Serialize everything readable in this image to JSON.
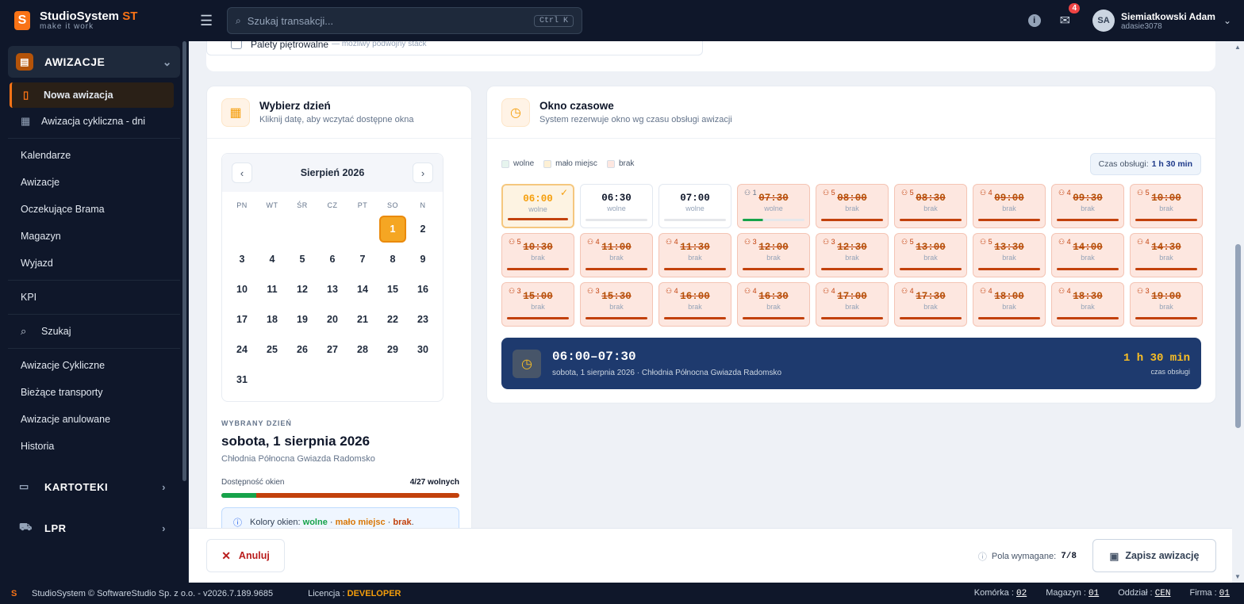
{
  "app": {
    "name": "StudioSystem",
    "suffix": "ST",
    "tagline": "make it work"
  },
  "search": {
    "placeholder": "Szukaj transakcji...",
    "shortcut": "Ctrl K"
  },
  "header": {
    "info_icon": "info-icon",
    "mail_badge": "4",
    "user_name": "Siemiatkowski Adam",
    "user_login": "adasie3078"
  },
  "sidebar": {
    "group1": "AWIZACJE",
    "sub": [
      {
        "label": "Nowa awizacja"
      },
      {
        "label": "Awizacja cykliczna - dni"
      }
    ],
    "items": [
      "Kalendarze",
      "Awizacje",
      "Oczekujące Brama",
      "Magazyn",
      "Wyjazd",
      "KPI",
      "Szukaj",
      "Awizacje Cykliczne",
      "Bieżące transporty",
      "Awizacje anulowane",
      "Historia"
    ],
    "group2": "KARTOTEKI",
    "group3": "LPR"
  },
  "pallets": {
    "label": "Palety piętrowalne",
    "note": "— możliwy podwójny stack"
  },
  "day_card": {
    "title": "Wybierz dzień",
    "subtitle": "Kliknij datę, aby wczytać dostępne okna"
  },
  "calendar": {
    "month": "Sierpień 2026",
    "weekdays": [
      "PN",
      "WT",
      "ŚR",
      "CZ",
      "PT",
      "SO",
      "N"
    ],
    "days": [
      "",
      "",
      "",
      "",
      "",
      "1",
      "2",
      "3",
      "4",
      "5",
      "6",
      "7",
      "8",
      "9",
      "10",
      "11",
      "12",
      "13",
      "14",
      "15",
      "16",
      "17",
      "18",
      "19",
      "20",
      "21",
      "22",
      "23",
      "24",
      "25",
      "26",
      "27",
      "28",
      "29",
      "30",
      "31"
    ],
    "selected": "1"
  },
  "picked": {
    "label": "WYBRANY DZIEŃ",
    "date": "sobota, 1 sierpnia 2026",
    "location": "Chłodnia Północna Gwiazda Radomsko",
    "avail_label": "Dostępność okien",
    "avail_value": "4/27 wolnych",
    "avail_fraction": 0.148,
    "info_prefix": "Kolory okien:",
    "info_free": "wolne",
    "info_few": "mało miejsc",
    "info_none": "brak"
  },
  "window_card": {
    "title": "Okno czasowe",
    "subtitle": "System rezerwuje okno wg czasu obsługi awizacji"
  },
  "legend": [
    {
      "label": "wolne",
      "color": "#e6f4ee"
    },
    {
      "label": "mało miejsc",
      "color": "#fdf0d5"
    },
    {
      "label": "brak",
      "color": "#fde7e0"
    }
  ],
  "service_time": {
    "label": "Czas obsługi:",
    "value": "1 h 30 min"
  },
  "slots": [
    {
      "time": "06:00",
      "status": "wolne",
      "kind": "selected",
      "people": ""
    },
    {
      "time": "06:30",
      "status": "wolne",
      "kind": "free",
      "people": ""
    },
    {
      "time": "07:00",
      "status": "wolne",
      "kind": "free",
      "people": ""
    },
    {
      "time": "07:30",
      "status": "wolne",
      "kind": "partial",
      "people": "1"
    },
    {
      "time": "08:00",
      "status": "brak",
      "kind": "full",
      "people": "5"
    },
    {
      "time": "08:30",
      "status": "brak",
      "kind": "full",
      "people": "5"
    },
    {
      "time": "09:00",
      "status": "brak",
      "kind": "full",
      "people": "4"
    },
    {
      "time": "09:30",
      "status": "brak",
      "kind": "full",
      "people": "4"
    },
    {
      "time": "10:00",
      "status": "brak",
      "kind": "full",
      "people": "5"
    },
    {
      "time": "10:30",
      "status": "brak",
      "kind": "full",
      "people": "5"
    },
    {
      "time": "11:00",
      "status": "brak",
      "kind": "full",
      "people": "4"
    },
    {
      "time": "11:30",
      "status": "brak",
      "kind": "full",
      "people": "4"
    },
    {
      "time": "12:00",
      "status": "brak",
      "kind": "full",
      "people": "3"
    },
    {
      "time": "12:30",
      "status": "brak",
      "kind": "full",
      "people": "3"
    },
    {
      "time": "13:00",
      "status": "brak",
      "kind": "full",
      "people": "5"
    },
    {
      "time": "13:30",
      "status": "brak",
      "kind": "full",
      "people": "5"
    },
    {
      "time": "14:00",
      "status": "brak",
      "kind": "full",
      "people": "4"
    },
    {
      "time": "14:30",
      "status": "brak",
      "kind": "full",
      "people": "4"
    },
    {
      "time": "15:00",
      "status": "brak",
      "kind": "full",
      "people": "3"
    },
    {
      "time": "15:30",
      "status": "brak",
      "kind": "full",
      "people": "3"
    },
    {
      "time": "16:00",
      "status": "brak",
      "kind": "full",
      "people": "4"
    },
    {
      "time": "16:30",
      "status": "brak",
      "kind": "full",
      "people": "4"
    },
    {
      "time": "17:00",
      "status": "brak",
      "kind": "full",
      "people": "4"
    },
    {
      "time": "17:30",
      "status": "brak",
      "kind": "full",
      "people": "4"
    },
    {
      "time": "18:00",
      "status": "brak",
      "kind": "full",
      "people": "4"
    },
    {
      "time": "18:30",
      "status": "brak",
      "kind": "full",
      "people": "4"
    },
    {
      "time": "19:00",
      "status": "brak",
      "kind": "full",
      "people": "3"
    }
  ],
  "summary": {
    "range": "06:00–07:30",
    "detail": "sobota, 1 sierpnia 2026 · Chłodnia Północna Gwiazda Radomsko",
    "duration": "1 h 30 min",
    "duration_label": "czas obsługi"
  },
  "actions": {
    "cancel": "Anuluj",
    "required_label": "Pola wymagane:",
    "required_value": "7/8",
    "save": "Zapisz awizację"
  },
  "status": {
    "copyright": "StudioSystem © SoftwareStudio Sp. z o.o. - v2026.7.189.9685",
    "license_label": "Licencja :",
    "license": "DEVELOPER",
    "cell_label": "Komórka :",
    "cell": "02",
    "wh_label": "Magazyn :",
    "wh": "01",
    "dept_label": "Oddział :",
    "dept": "CEN",
    "firm_label": "Firma :",
    "firm": "01"
  }
}
